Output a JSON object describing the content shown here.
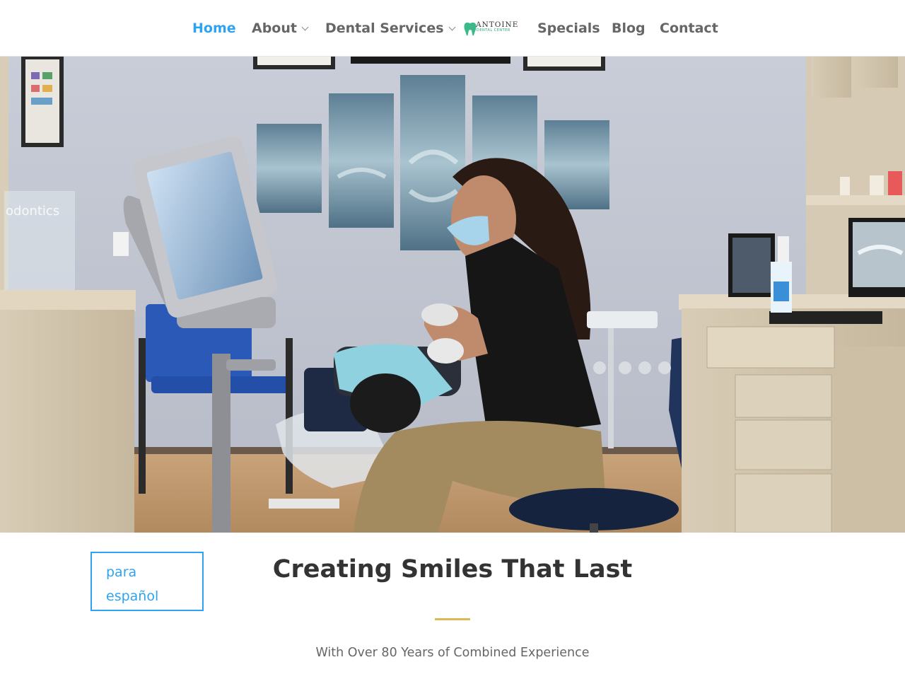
{
  "nav": {
    "home": "Home",
    "about": "About",
    "dental_services": "Dental Services",
    "specials": "Specials",
    "blog": "Blog",
    "contact": "Contact",
    "logo_text": "ANTOINE",
    "logo_subtext": "DENTAL CENTER",
    "dropdown_icon": "chevron-down-icon"
  },
  "hero": {
    "wall_sign_text": "odontics"
  },
  "content": {
    "espanol_link": "para español",
    "headline": "Creating Smiles That Last",
    "subheadline": "With Over 80 Years of Combined Experience"
  },
  "colors": {
    "accent": "#2ea3f2",
    "divider": "#e0b65a",
    "nav_text": "#666666",
    "headline": "#333333"
  }
}
